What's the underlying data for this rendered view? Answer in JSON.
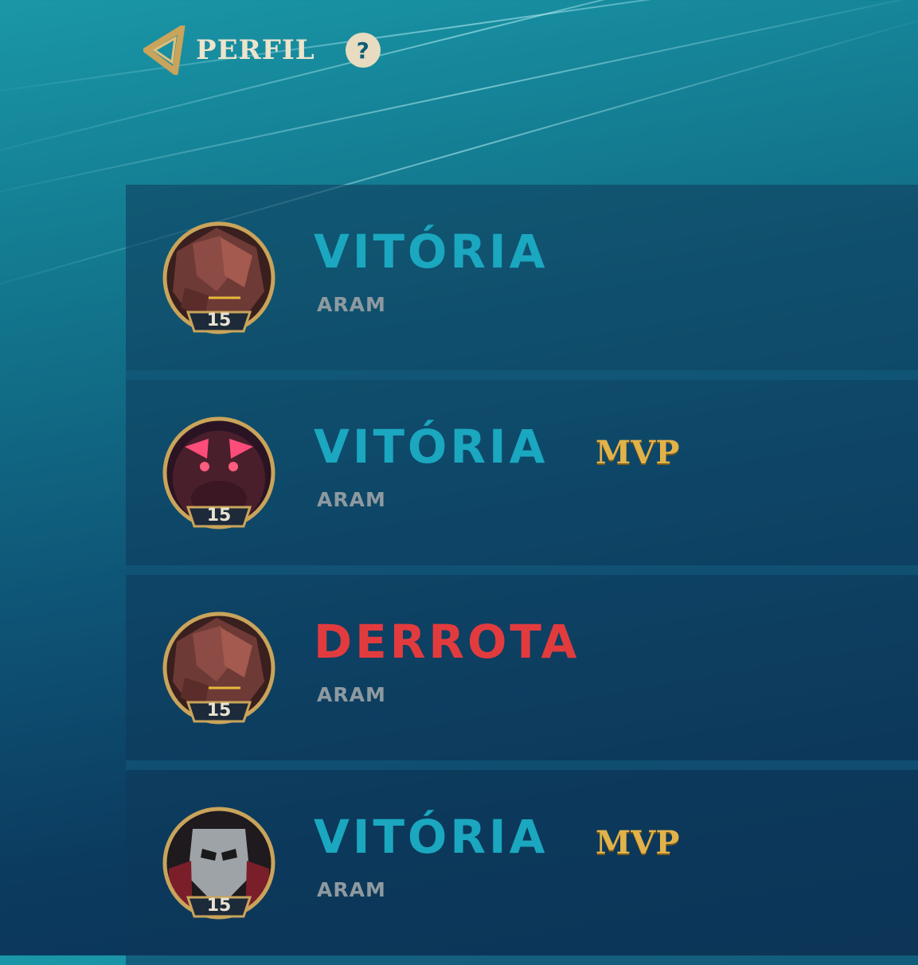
{
  "header": {
    "title": "PERFIL",
    "help_label": "?"
  },
  "colors": {
    "win": "#1aa7bf",
    "loss": "#e23b3e",
    "mvp": "#e2b24a",
    "frame": "#c9a45a"
  },
  "matches": [
    {
      "result": "VITÓRIA",
      "outcome": "win",
      "mode": "ARAM",
      "level": "15",
      "mvp": "",
      "champion_icon": "champion-portrait-rock"
    },
    {
      "result": "VITÓRIA",
      "outcome": "win",
      "mode": "ARAM",
      "level": "15",
      "mvp": "MVP",
      "champion_icon": "champion-portrait-dark-beast"
    },
    {
      "result": "DERROTA",
      "outcome": "loss",
      "mode": "ARAM",
      "level": "15",
      "mvp": "",
      "champion_icon": "champion-portrait-rock"
    },
    {
      "result": "VITÓRIA",
      "outcome": "win",
      "mode": "ARAM",
      "level": "15",
      "mvp": "MVP",
      "champion_icon": "champion-portrait-masked"
    }
  ]
}
